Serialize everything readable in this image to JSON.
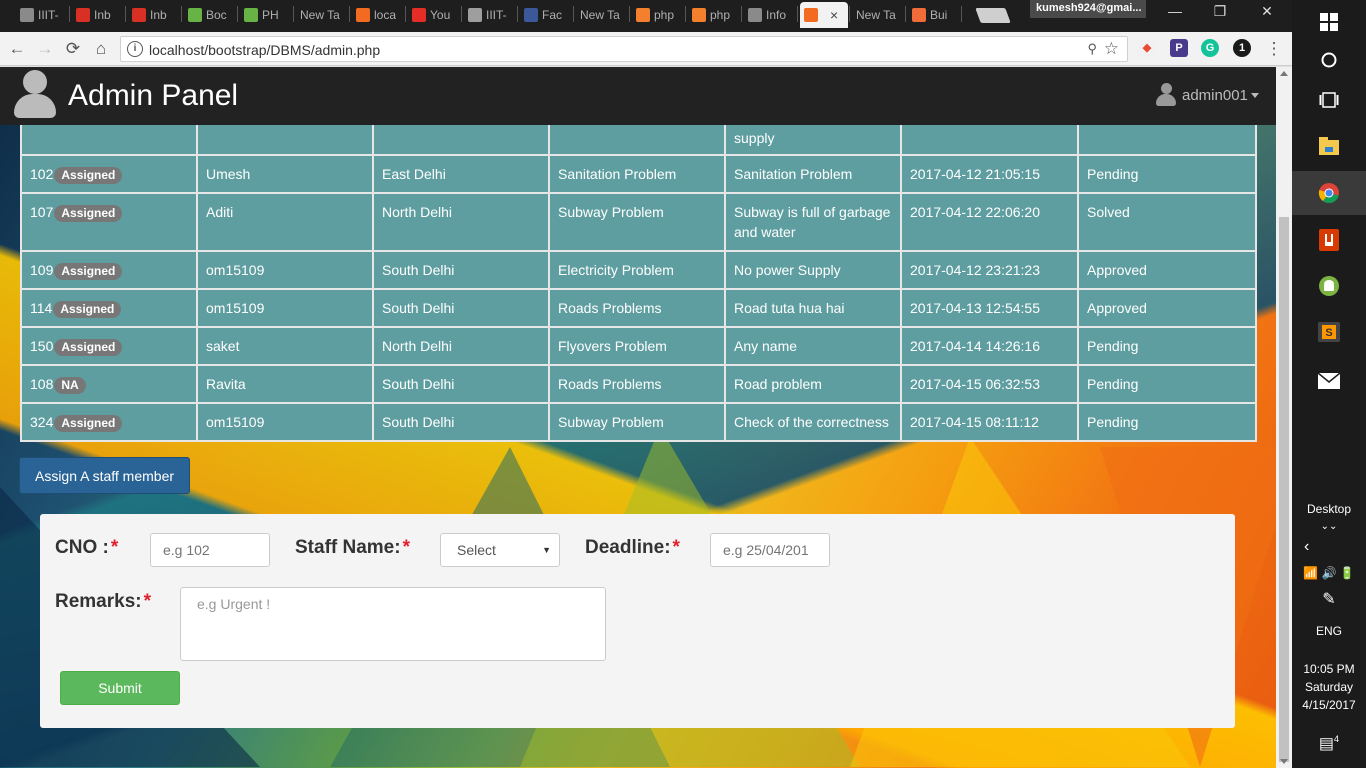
{
  "browser": {
    "tabs": [
      {
        "label": "IIIT-",
        "color": "#8a8a8a"
      },
      {
        "label": "Inb",
        "color": "#d93025"
      },
      {
        "label": "Inb",
        "color": "#d93025"
      },
      {
        "label": "Boc",
        "color": "#67b346"
      },
      {
        "label": "PH",
        "color": "#67b346"
      },
      {
        "label": "New Ta",
        "color": ""
      },
      {
        "label": "loca",
        "color": "#f26b21"
      },
      {
        "label": "You",
        "color": "#e52d27"
      },
      {
        "label": "IIIT-",
        "color": "#9e9e9e"
      },
      {
        "label": "Fac",
        "color": "#3b5998"
      },
      {
        "label": "New Ta",
        "color": ""
      },
      {
        "label": "php",
        "color": "#f4802e"
      },
      {
        "label": "php",
        "color": "#f4802e"
      },
      {
        "label": "Info",
        "color": "#8a8a8a"
      },
      {
        "label": "",
        "color": "#f26b21",
        "active": true
      },
      {
        "label": "New Ta",
        "color": ""
      },
      {
        "label": "Bui",
        "color": "#f06c38"
      }
    ],
    "active_tab_close": "×",
    "profile": "kumesh924@gmai...",
    "window_controls": [
      "—",
      "❐",
      "✕"
    ],
    "url": "localhost/bootstrap/DBMS/admin.php",
    "nav": {
      "back": "←",
      "forward": "→",
      "reload": "⟳",
      "home": "⌂"
    },
    "omnibox_icons": {
      "info": "i",
      "key": "⚲",
      "star": "☆"
    },
    "extensions": [
      {
        "label": "◆",
        "color": "#f1f1f1",
        "text_color": "#e94a35"
      },
      {
        "label": "P",
        "color": "#4a3a8c",
        "text_color": "#ffffff"
      },
      {
        "label": "G",
        "color": "#15c39a",
        "text_color": "#ffffff"
      },
      {
        "label": "1",
        "color": "#1a1a1a",
        "text_color": "#ffffff"
      }
    ],
    "menu_icon": "⋮"
  },
  "navbar": {
    "brand": "Admin Panel",
    "user": "admin001"
  },
  "table": {
    "partial_row": [
      "",
      "",
      "",
      "",
      "supply",
      "",
      ""
    ],
    "rows": [
      {
        "cno": "102",
        "badge": "Assigned",
        "name": "Umesh",
        "area": "East Delhi",
        "type": "Sanitation Problem",
        "desc": "Sanitation Problem",
        "date": "2017-04-12 21:05:15",
        "status": "Pending"
      },
      {
        "cno": "107",
        "badge": "Assigned",
        "name": "Aditi",
        "area": "North Delhi",
        "type": "Subway Problem",
        "desc": "Subway is full of garbage and water",
        "date": "2017-04-12 22:06:20",
        "status": "Solved"
      },
      {
        "cno": "109",
        "badge": "Assigned",
        "name": "om15109",
        "area": "South Delhi",
        "type": "Electricity Problem",
        "desc": "No power Supply",
        "date": "2017-04-12 23:21:23",
        "status": "Approved"
      },
      {
        "cno": "114",
        "badge": "Assigned",
        "name": "om15109",
        "area": "South Delhi",
        "type": "Roads Problems",
        "desc": "Road tuta hua hai",
        "date": "2017-04-13 12:54:55",
        "status": "Approved"
      },
      {
        "cno": "150",
        "badge": "Assigned",
        "name": "saket",
        "area": "North Delhi",
        "type": "Flyovers Problem",
        "desc": "Any name",
        "date": "2017-04-14 14:26:16",
        "status": "Pending"
      },
      {
        "cno": "108",
        "badge": "NA",
        "name": "Ravita",
        "area": "South Delhi",
        "type": "Roads Problems",
        "desc": "Road problem",
        "date": "2017-04-15 06:32:53",
        "status": "Pending"
      },
      {
        "cno": "324",
        "badge": "Assigned",
        "name": "om15109",
        "area": "South Delhi",
        "type": "Subway Problem",
        "desc": "Check of the correctness",
        "date": "2017-04-15 08:11:12",
        "status": "Pending"
      }
    ]
  },
  "assign_button": "Assign A staff member",
  "form": {
    "cno_label": "CNO :",
    "cno_placeholder": "e.g 102",
    "staff_label": "Staff Name:",
    "staff_selected": "Select",
    "deadline_label": "Deadline:",
    "deadline_placeholder": "e.g 25/04/201",
    "remarks_label": "Remarks:",
    "remarks_placeholder": "e.g Urgent !",
    "required_mark": "*",
    "submit": "Submit"
  },
  "taskbar": {
    "icons": [
      "windows-logo-icon",
      "cortana-icon",
      "task-view-icon",
      "file-explorer-icon",
      "chrome-icon",
      "office-icon",
      "android-icon",
      "sublime-icon",
      "mail-icon"
    ],
    "desktop_label": "Desktop",
    "language": "ENG",
    "time": "10:05 PM",
    "day": "Saturday",
    "date": "4/15/2017",
    "notifications": "4"
  }
}
